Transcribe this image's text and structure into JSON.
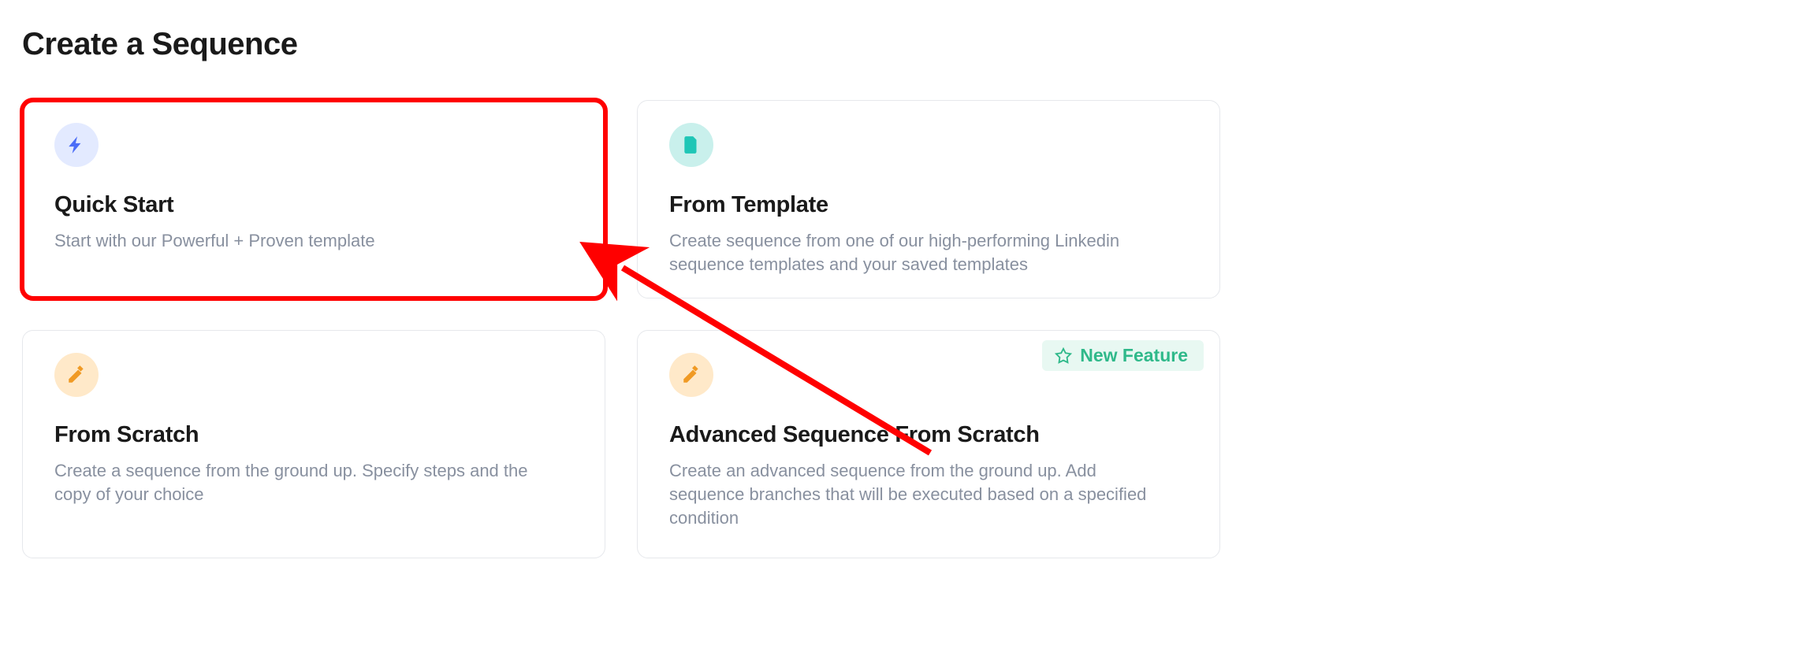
{
  "page_title": "Create a Sequence",
  "cards": {
    "quick_start": {
      "title": "Quick Start",
      "desc": "Start with our Powerful + Proven template",
      "icon": "bolt"
    },
    "from_template": {
      "title": "From Template",
      "desc": "Create sequence from one of our high-performing Linkedin sequence templates and your saved templates",
      "icon": "file"
    },
    "from_scratch": {
      "title": "From Scratch",
      "desc": "Create a sequence from the ground up. Specify steps and the copy of your choice",
      "icon": "pen"
    },
    "advanced": {
      "title": "Advanced Sequence From Scratch",
      "desc": "Create an advanced sequence from the ground up. Add sequence branches that will be executed based on a specified condition",
      "icon": "pen",
      "badge": "New Feature"
    }
  },
  "annotation": {
    "type": "arrow-and-box",
    "target": "quick_start"
  }
}
